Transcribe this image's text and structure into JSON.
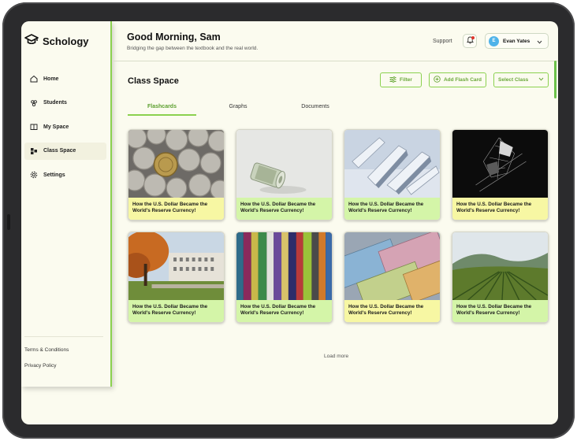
{
  "app": {
    "logo_text": "Schology"
  },
  "sidebar": {
    "items": [
      {
        "label": "Home",
        "icon": "home-icon",
        "active": false
      },
      {
        "label": "Students",
        "icon": "users-icon",
        "active": false
      },
      {
        "label": "My Space",
        "icon": "book-icon",
        "active": false
      },
      {
        "label": "Class Space",
        "icon": "blocks-icon",
        "active": true
      },
      {
        "label": "Settings",
        "icon": "gear-icon",
        "active": false
      }
    ],
    "footer": [
      {
        "label": "Terms & Conditions"
      },
      {
        "label": "Privacy Policy"
      }
    ]
  },
  "header": {
    "greeting": "Good Morning, Sam",
    "subtitle": "Bridging the gap between the textbook and the real world.",
    "support": "Support",
    "user": {
      "initial": "E",
      "name": "Evan Yates"
    }
  },
  "main": {
    "title": "Class Space",
    "filter_label": "Filter",
    "add_label": "Add Flash Card",
    "select_label": "Select Class",
    "tabs": [
      {
        "label": "Flashcards",
        "active": true
      },
      {
        "label": "Graphs",
        "active": false
      },
      {
        "label": "Documents",
        "active": false
      }
    ],
    "cards": [
      {
        "caption": "How the U.S. Dollar Became the World's Reserve Currency!",
        "image": "coins",
        "caption_color": "yellow"
      },
      {
        "caption": "How the U.S. Dollar Became the World's Reserve Currency!",
        "image": "rolled-bill",
        "caption_color": "green"
      },
      {
        "caption": "How the U.S. Dollar Became the World's Reserve Currency!",
        "image": "shards",
        "caption_color": "green"
      },
      {
        "caption": "How the U.S. Dollar Became the World's Reserve Currency!",
        "image": "dark-sculpture",
        "caption_color": "yellow"
      },
      {
        "caption": "How the U.S. Dollar Became the World's Reserve Currency!",
        "image": "autumn-building",
        "caption_color": "green"
      },
      {
        "caption": "How the U.S. Dollar Became the World's Reserve Currency!",
        "image": "books",
        "caption_color": "green"
      },
      {
        "caption": "How the U.S. Dollar Became the World's Reserve Currency!",
        "image": "euro-notes",
        "caption_color": "yellow"
      },
      {
        "caption": "How the U.S. Dollar Became the World's Reserve Currency!",
        "image": "vineyard",
        "caption_color": "green"
      }
    ],
    "load_more": "Load more"
  },
  "colors": {
    "accent": "#8bd14f",
    "accent_text": "#5b9f2d",
    "background": "#fbfbef",
    "caption_green": "#d4f5a8",
    "caption_yellow": "#f7f7a3"
  }
}
